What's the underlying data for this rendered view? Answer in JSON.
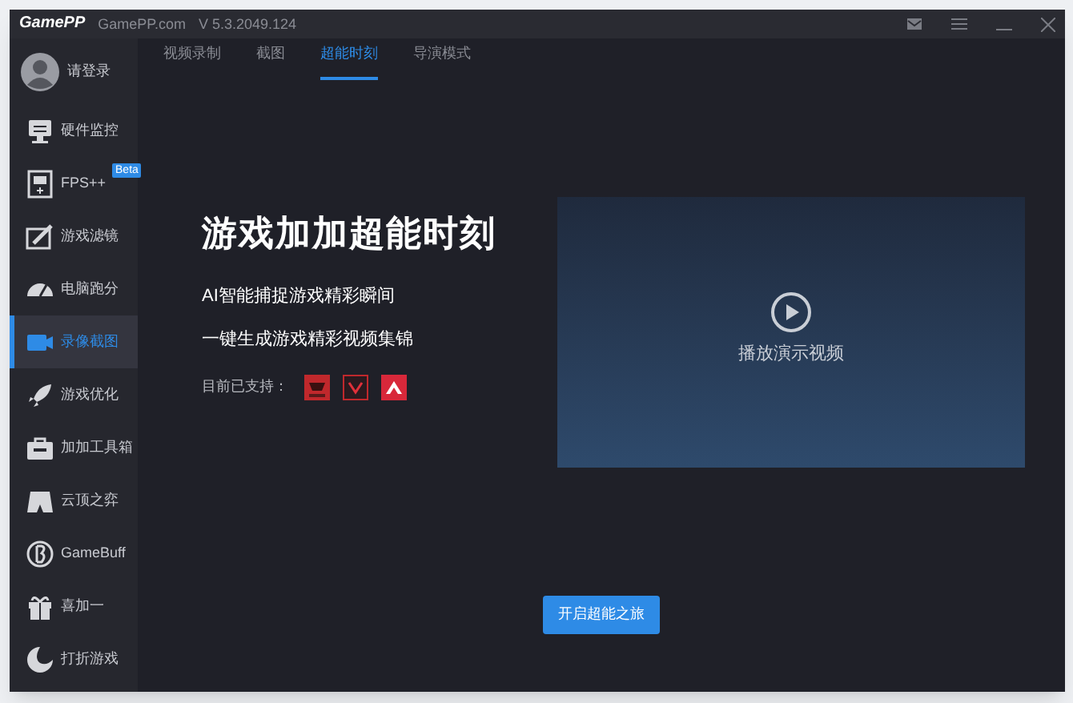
{
  "window": {
    "logo": "GamePP",
    "site": "GamePP.com",
    "version": "V 5.3.2049.124"
  },
  "user": {
    "label": "请登录"
  },
  "sidebar": {
    "items": [
      {
        "label": "硬件监控",
        "selected": false
      },
      {
        "label": "FPS++",
        "selected": false,
        "badge": "Beta"
      },
      {
        "label": "游戏滤镜",
        "selected": false
      },
      {
        "label": "电脑跑分",
        "selected": false
      },
      {
        "label": "录像截图",
        "selected": true
      },
      {
        "label": "游戏优化",
        "selected": false
      },
      {
        "label": "加加工具箱",
        "selected": false
      },
      {
        "label": "云顶之弈",
        "selected": false
      },
      {
        "label": "GameBuff",
        "selected": false
      },
      {
        "label": "喜加一",
        "selected": false
      },
      {
        "label": "打折游戏",
        "selected": false
      }
    ]
  },
  "tabs": [
    {
      "label": "视频录制",
      "selected": false
    },
    {
      "label": "截图",
      "selected": false
    },
    {
      "label": "超能时刻",
      "selected": true
    },
    {
      "label": "导演模式",
      "selected": false
    }
  ],
  "hero": {
    "title": "游戏加加超能时刻",
    "lines": [
      "AI智能捕捉游戏精彩瞬间",
      "一键生成游戏精彩视频集锦"
    ],
    "support_label": "目前已支持：",
    "games": [
      {
        "kind": "badge"
      },
      {
        "kind": "outline"
      },
      {
        "kind": "peak"
      }
    ]
  },
  "video": {
    "label": "播放演示视频"
  },
  "start_button": "开启超能之旅"
}
